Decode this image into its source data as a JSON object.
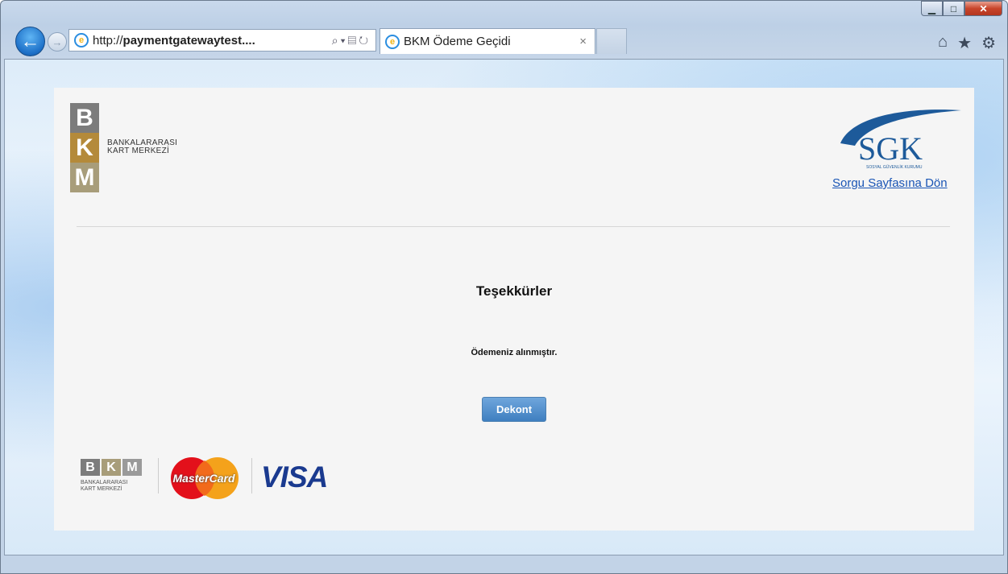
{
  "browser": {
    "url_prefix": "http://",
    "url_domain": "paymentgatewaytest....",
    "tab_title": "BKM Ödeme Geçidi",
    "tab_close": "×"
  },
  "bkm": {
    "letters": [
      "B",
      "K",
      "M"
    ],
    "text_line1": "BANKALARARASI",
    "text_line2": "KART MERKEZİ"
  },
  "sgk": {
    "logo_text": "SGK",
    "logo_subtext": "SOSYAL GÜVENLİK KURUMU",
    "link_label": "Sorgu Sayfasına Dön"
  },
  "main": {
    "title": "Teşekkürler",
    "message": "Ödemeniz alınmıştır.",
    "button_label": "Dekont"
  },
  "footer": {
    "bkm_letters": [
      "B",
      "K",
      "M"
    ],
    "bkm_line1": "BANKALARARASI",
    "bkm_line2": "KART MERKEZİ",
    "mastercard": "MasterCard",
    "visa": "VISA"
  },
  "colors": {
    "bkm_gray": "#7c7c7c",
    "bkm_gold": "#b48a3a",
    "bkm_tan": "#a89d7a",
    "link": "#1a55b5",
    "button": "#4f8fcf"
  }
}
